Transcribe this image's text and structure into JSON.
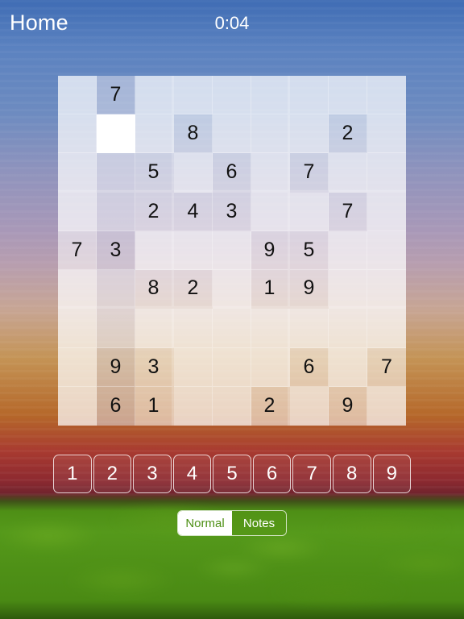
{
  "header": {
    "home_label": "Home",
    "timer": "0:04"
  },
  "board": {
    "rows": 9,
    "cols": 9,
    "selected": {
      "row": 1,
      "col": 1
    },
    "cells": [
      [
        "",
        "7",
        "",
        "",
        "",
        "",
        "",
        "",
        ""
      ],
      [
        "",
        "",
        "",
        "8",
        "",
        "",
        "",
        "2",
        ""
      ],
      [
        "",
        "",
        "5",
        "",
        "6",
        "",
        "7",
        "",
        ""
      ],
      [
        "",
        "",
        "2",
        "4",
        "3",
        "",
        "",
        "7",
        ""
      ],
      [
        "7",
        "3",
        "",
        "",
        "",
        "9",
        "5",
        "",
        ""
      ],
      [
        "",
        "",
        "8",
        "2",
        "",
        "1",
        "9",
        "",
        ""
      ],
      [
        "",
        "",
        "",
        "",
        "",
        "",
        "",
        "",
        ""
      ],
      [
        "",
        "9",
        "3",
        "",
        "",
        "",
        "6",
        "",
        "7"
      ],
      [
        "",
        "6",
        "1",
        "",
        "",
        "2",
        "",
        "9",
        ""
      ]
    ]
  },
  "numpad": {
    "buttons": [
      "1",
      "2",
      "3",
      "4",
      "5",
      "6",
      "7",
      "8",
      "9"
    ]
  },
  "mode": {
    "options": [
      "Normal",
      "Notes"
    ],
    "selected": "Normal",
    "active_text_color": "#4e9016",
    "active_bg_color": "#ffffff",
    "inactive_bg_color": "#569616"
  },
  "theme": {
    "sky_top": "#5b82c0",
    "sky_mid": "#a898b8",
    "sky_gold": "#c49355",
    "sky_red": "#a83a30",
    "grass": "#4e8f16",
    "header_text": "#ffffff",
    "digit_color": "#111111"
  }
}
